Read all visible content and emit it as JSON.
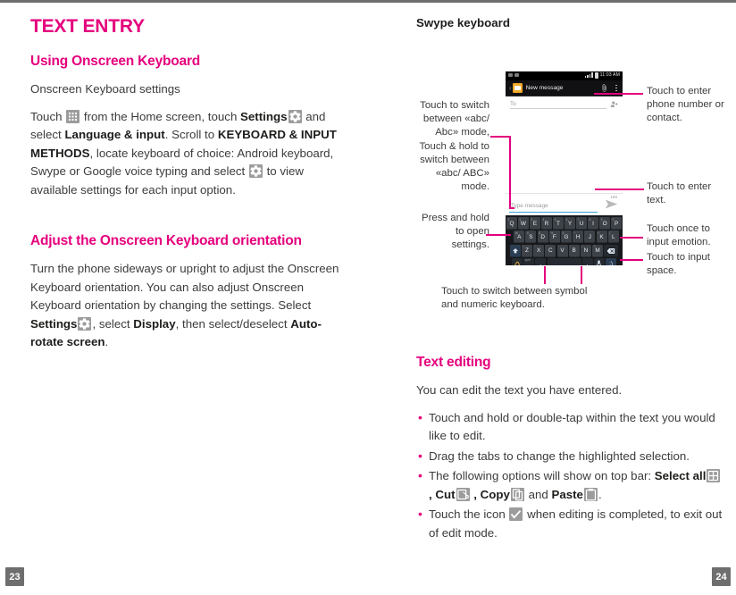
{
  "left_column": {
    "chapter_title": "TEXT ENTRY",
    "section1_title": "Using Onscreen Keyboard",
    "section1_sub": "Onscreen Keyboard settings",
    "section1_p1_a": "Touch ",
    "section1_p1_b": " from the Home screen, touch ",
    "section1_p1_settings": "Settings",
    "section1_p1_c": " and select ",
    "section1_p1_lang": "Language & input",
    "section1_p1_d": ". Scroll to ",
    "section1_p1_kbd": "KEYBOARD & INPUT METHODS",
    "section1_p1_e": ", locate keyboard of choice: Android keyboard, Swype or Google voice typing and select ",
    "section1_p1_f": " to view available settings for each input option.",
    "section2_title": "Adjust the Onscreen Keyboard orientation",
    "section2_p1_a": "Turn the phone sideways or upright to adjust the Onscreen Keyboard orientation. You can also adjust Onscreen Keyboard orientation by changing the settings. Select ",
    "section2_p1_settings": "Settings",
    "section2_p1_b": ", select ",
    "section2_p1_display": "Display",
    "section2_p1_c": ", then select/deselect ",
    "section2_p1_autorotate": "Auto-rotate screen",
    "section2_p1_d": "."
  },
  "right_column": {
    "figure_caption": "Swype keyboard",
    "phone": {
      "status_time": "11:03 AM",
      "appbar_title": "New message",
      "to_placeholder": "To",
      "char_count": "160",
      "type_placeholder": "Type message",
      "keys_row1": [
        "Q",
        "W",
        "E",
        "R",
        "T",
        "Y",
        "U",
        "I",
        "O",
        "P"
      ],
      "keys_row1_alt": [
        "1",
        "2",
        "3",
        "4",
        "5",
        "6",
        "7",
        "8",
        "9",
        "0"
      ],
      "keys_row2": [
        "A",
        "S",
        "D",
        "F",
        "G",
        "H",
        "J",
        "K",
        "L"
      ],
      "keys_row2_alt": [
        "@",
        "#",
        "$",
        "%",
        "&",
        "*",
        "-",
        "+",
        "("
      ],
      "keys_row3": [
        "Z",
        "X",
        "C",
        "V",
        "B",
        "N",
        "M"
      ],
      "keys_row3_alt": [
        "!",
        "\"",
        "'",
        ":",
        ";",
        "/",
        "?"
      ],
      "key_shift": "shift-key",
      "key_backspace": "backspace-key",
      "key_swype": "swype-key",
      "key_sym": "sym",
      "key_comma": ",",
      "key_period": ".",
      "key_mic": "mic-key",
      "key_emoticon": ":)"
    },
    "callouts": {
      "enter_phone": "Touch to enter phone number or contact.",
      "enter_text": "Touch to enter text.",
      "input_emotion": "Touch once to input emotion.",
      "input_space": "Touch to input space.",
      "abc_mode": "Touch to switch between «abc/ Abc» mode, Touch & hold to switch between «abc/ ABC» mode.",
      "press_hold_settings": "Press and hold to open settings.",
      "symbol_numeric": "Touch to switch between symbol and numeric keyboard."
    },
    "text_editing": {
      "title": "Text editing",
      "intro": "You can edit the text you have entered.",
      "bullets": [
        {
          "text_a": "Touch and hold or double-tap within the text you would like to edit."
        },
        {
          "text_a": "Drag the tabs to change the highlighted selection."
        },
        {
          "text_a": "The following options will show on top bar: ",
          "select_all": "Select all",
          "sep1": " , ",
          "cut": "Cut",
          "sep2": " , ",
          "copy": "Copy",
          "sep3": " and ",
          "paste": "Paste",
          "end": "."
        },
        {
          "text_a": "Touch the icon ",
          "text_b": " when editing is completed, to exit out of edit mode."
        }
      ]
    }
  },
  "footer": {
    "page_left": "23",
    "page_right": "24"
  },
  "colors": {
    "accent_magenta": "#e5007d",
    "body_text": "#3c3c3b",
    "page_number_bg": "#6e6e6e"
  }
}
